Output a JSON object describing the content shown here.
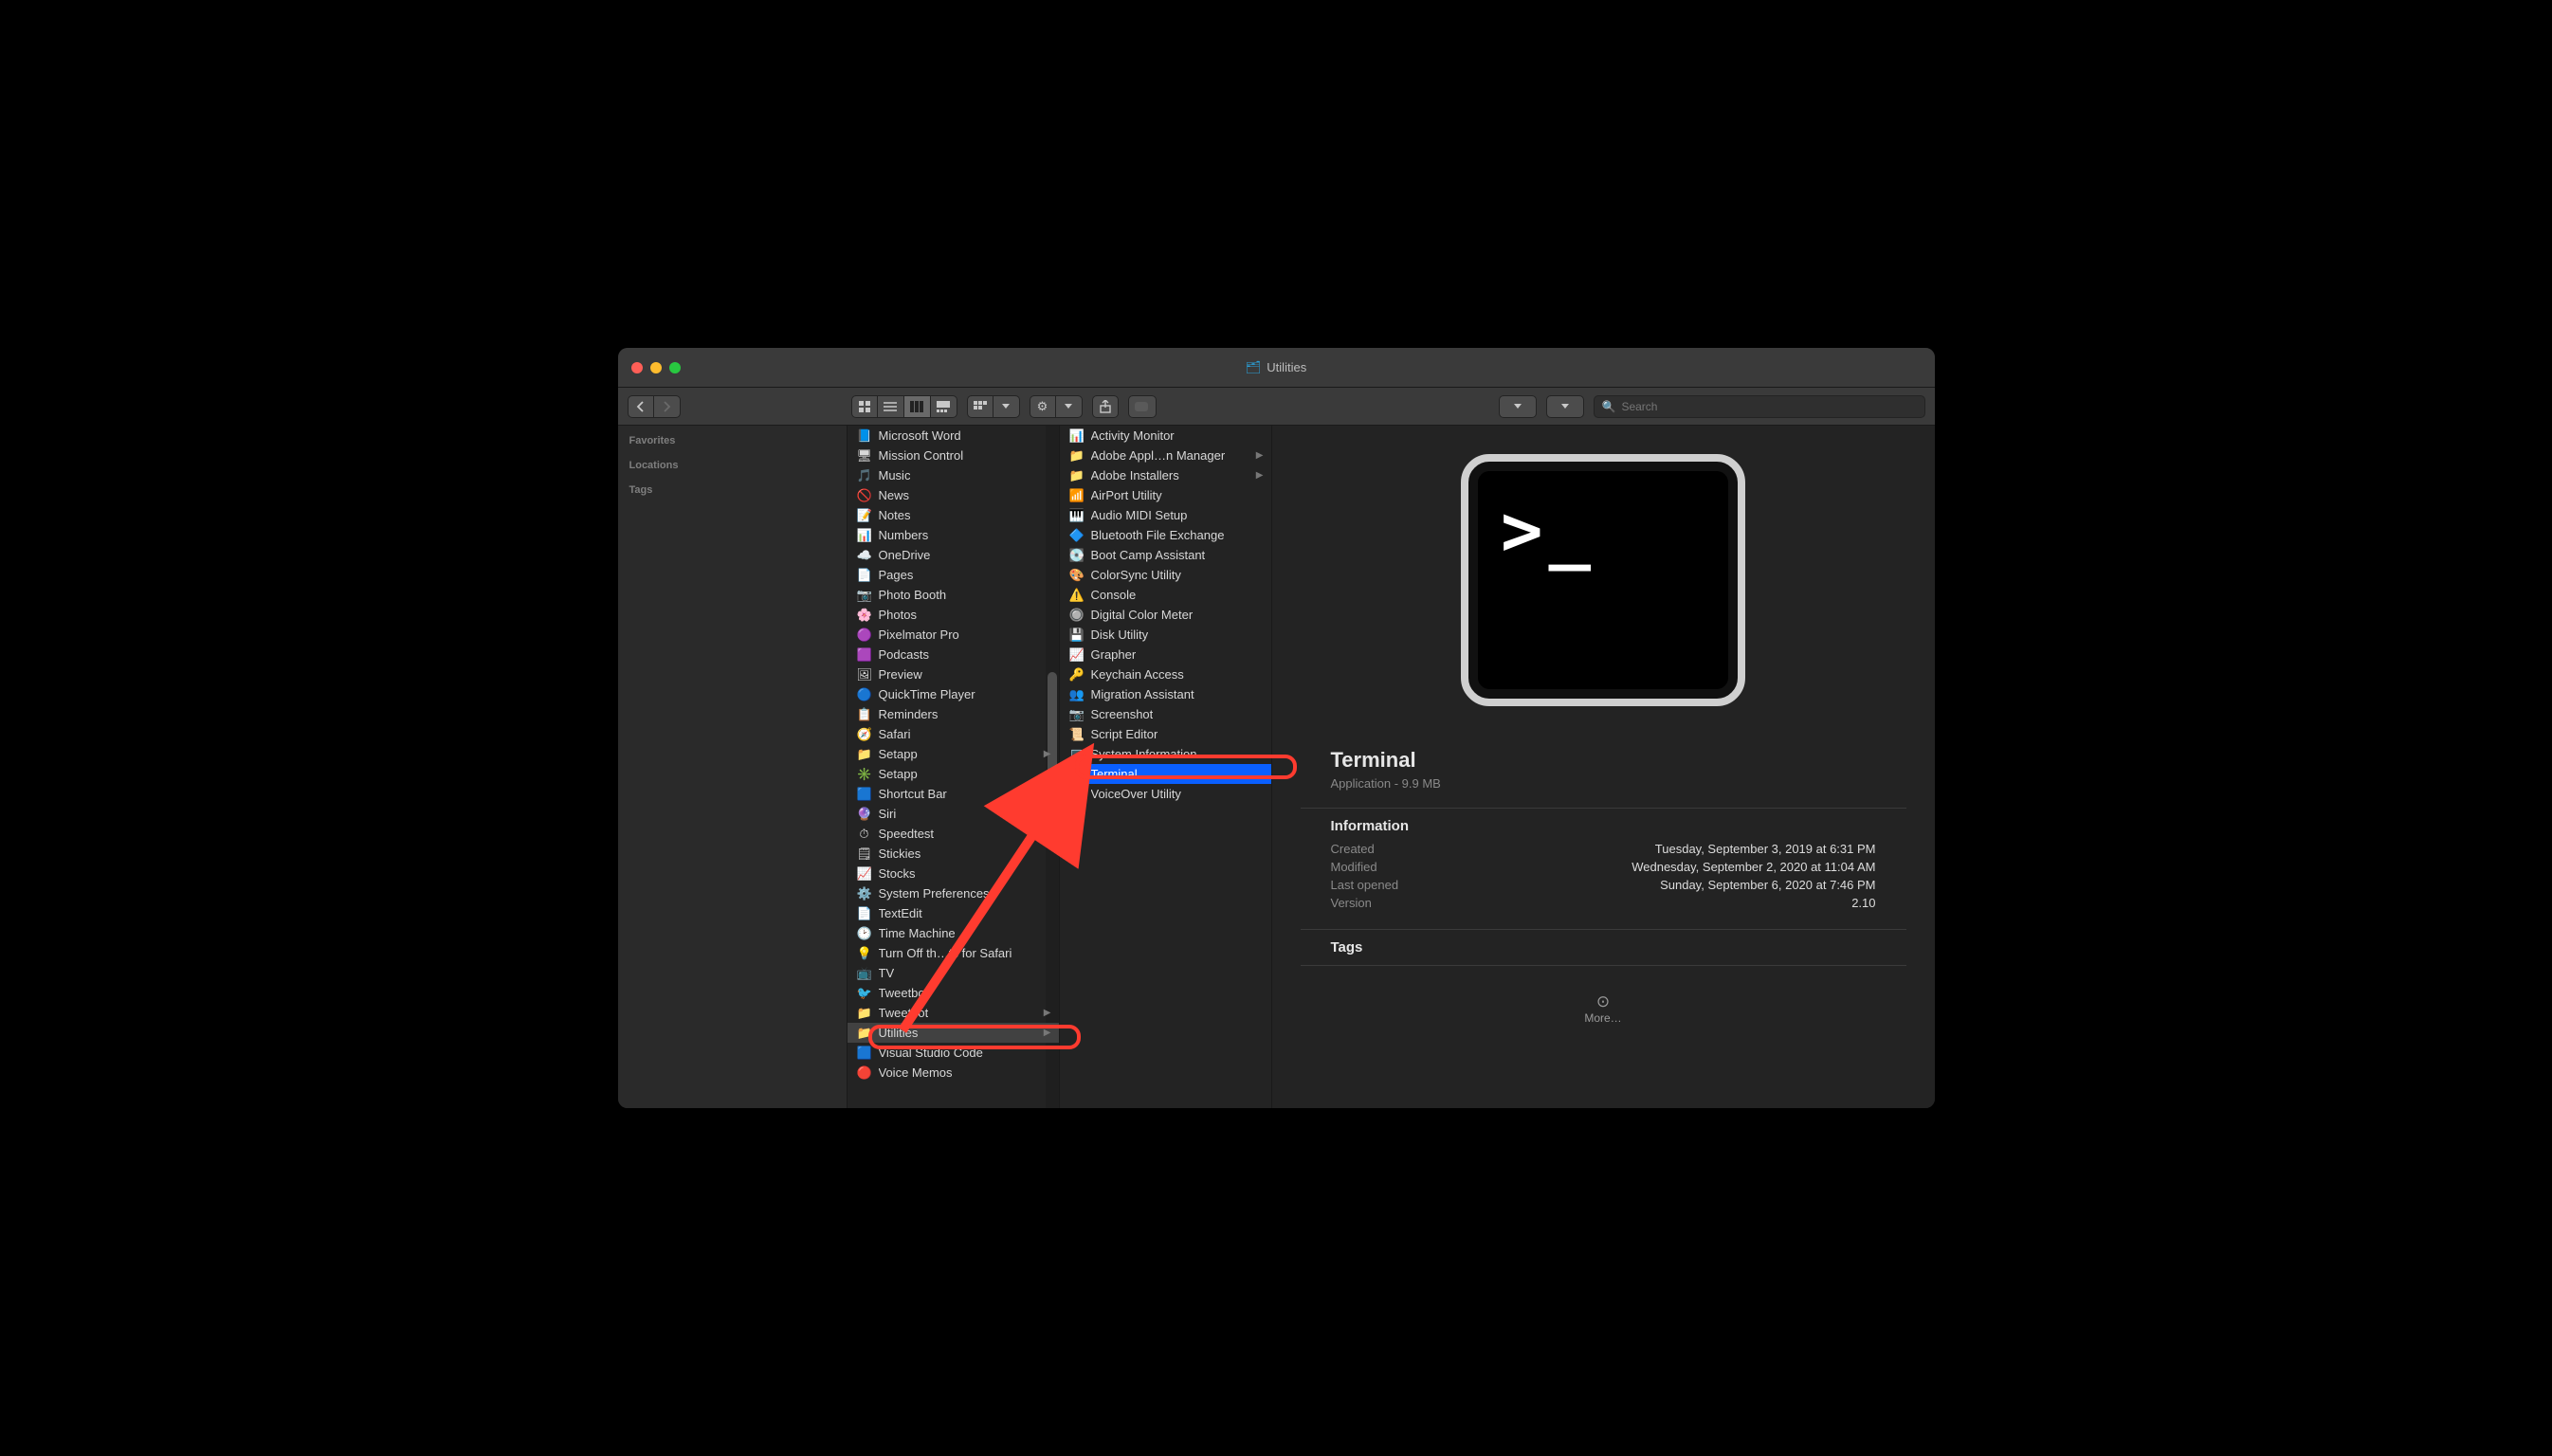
{
  "window": {
    "title": "Utilities"
  },
  "toolbar": {
    "search_placeholder": "Search"
  },
  "sidebar": {
    "sections": [
      "Favorites",
      "Locations",
      "Tags"
    ]
  },
  "col1": [
    {
      "label": "Microsoft Word",
      "icon": "📘"
    },
    {
      "label": "Mission Control",
      "icon": "🖥"
    },
    {
      "label": "Music",
      "icon": "🎵"
    },
    {
      "label": "News",
      "icon": "🚫"
    },
    {
      "label": "Notes",
      "icon": "📝"
    },
    {
      "label": "Numbers",
      "icon": "📊"
    },
    {
      "label": "OneDrive",
      "icon": "☁️"
    },
    {
      "label": "Pages",
      "icon": "📄"
    },
    {
      "label": "Photo Booth",
      "icon": "📷"
    },
    {
      "label": "Photos",
      "icon": "🌸"
    },
    {
      "label": "Pixelmator Pro",
      "icon": "🟣"
    },
    {
      "label": "Podcasts",
      "icon": "🟪"
    },
    {
      "label": "Preview",
      "icon": "🖼"
    },
    {
      "label": "QuickTime Player",
      "icon": "🔵"
    },
    {
      "label": "Reminders",
      "icon": "📋"
    },
    {
      "label": "Safari",
      "icon": "🧭"
    },
    {
      "label": "Setapp",
      "icon": "📁",
      "chev": true
    },
    {
      "label": "Setapp",
      "icon": "✳️"
    },
    {
      "label": "Shortcut Bar",
      "icon": "🟦"
    },
    {
      "label": "Siri",
      "icon": "🔮"
    },
    {
      "label": "Speedtest",
      "icon": "⏱"
    },
    {
      "label": "Stickies",
      "icon": "🗒"
    },
    {
      "label": "Stocks",
      "icon": "📈"
    },
    {
      "label": "System Preferences",
      "icon": "⚙️"
    },
    {
      "label": "TextEdit",
      "icon": "📄"
    },
    {
      "label": "Time Machine",
      "icon": "🕑"
    },
    {
      "label": "Turn Off th…ts for Safari",
      "icon": "💡"
    },
    {
      "label": "TV",
      "icon": "📺"
    },
    {
      "label": "Tweetbot",
      "icon": "🐦"
    },
    {
      "label": "Tweetbot",
      "icon": "📁",
      "chev": true
    },
    {
      "label": "Utilities",
      "icon": "📁",
      "chev": true,
      "selected": "dim"
    },
    {
      "label": "Visual Studio Code",
      "icon": "🟦"
    },
    {
      "label": "Voice Memos",
      "icon": "🔴"
    }
  ],
  "col2": [
    {
      "label": "Activity Monitor",
      "icon": "📊"
    },
    {
      "label": "Adobe Appl…n Manager",
      "icon": "📁",
      "chev": true
    },
    {
      "label": "Adobe Installers",
      "icon": "📁",
      "chev": true
    },
    {
      "label": "AirPort Utility",
      "icon": "📶"
    },
    {
      "label": "Audio MIDI Setup",
      "icon": "🎹"
    },
    {
      "label": "Bluetooth File Exchange",
      "icon": "🔷"
    },
    {
      "label": "Boot Camp Assistant",
      "icon": "💽"
    },
    {
      "label": "ColorSync Utility",
      "icon": "🎨"
    },
    {
      "label": "Console",
      "icon": "⚠️"
    },
    {
      "label": "Digital Color Meter",
      "icon": "🔘"
    },
    {
      "label": "Disk Utility",
      "icon": "💾"
    },
    {
      "label": "Grapher",
      "icon": "📈"
    },
    {
      "label": "Keychain Access",
      "icon": "🔑"
    },
    {
      "label": "Migration Assistant",
      "icon": "👥"
    },
    {
      "label": "Screenshot",
      "icon": "📷"
    },
    {
      "label": "Script Editor",
      "icon": "📜"
    },
    {
      "label": "System Information",
      "icon": "💻"
    },
    {
      "label": "Terminal",
      "icon": "⬛",
      "selected": "focus"
    },
    {
      "label": "VoiceOver Utility",
      "icon": "👤"
    }
  ],
  "preview": {
    "name": "Terminal",
    "subtitle": "Application - 9.9 MB",
    "section_info": "Information",
    "info": [
      {
        "k": "Created",
        "v": "Tuesday, September 3, 2019 at 6:31 PM"
      },
      {
        "k": "Modified",
        "v": "Wednesday, September 2, 2020 at 11:04 AM"
      },
      {
        "k": "Last opened",
        "v": "Sunday, September 6, 2020 at 7:46 PM"
      },
      {
        "k": "Version",
        "v": "2.10"
      }
    ],
    "section_tags": "Tags",
    "more": "More…"
  }
}
